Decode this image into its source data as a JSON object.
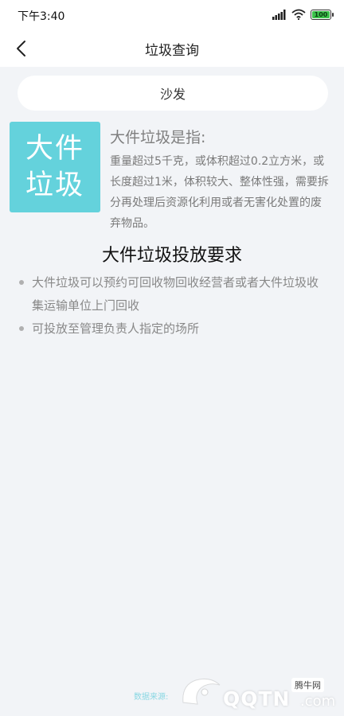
{
  "status_bar": {
    "time": "下午3:40",
    "battery_level": "100",
    "icons": [
      "signal-icon",
      "wifi-icon",
      "battery-icon"
    ],
    "battery_color": "#3cc24b"
  },
  "nav": {
    "title": "垃圾查询",
    "back_icon": "chevron-left-icon"
  },
  "search": {
    "value": "沙发"
  },
  "badge": {
    "line1": "大件",
    "line2": "垃圾",
    "color": "#64d2dc"
  },
  "definition": {
    "title": "大件垃圾是指:",
    "body": "重量超过5千克，或体积超过0.2立方米，或长度超过1米，体积较大、整体性强，需要拆分再处理后资源化利用或者无害化处置的废弃物品。"
  },
  "requirements": {
    "title": "大件垃圾投放要求",
    "items": [
      "大件垃圾可以预约可回收物回收经营者或者大件垃圾收集运输单位上门回收",
      "可投放至管理负责人指定的场所"
    ]
  },
  "footer": {
    "source_text": "数据来源:",
    "watermark_text": "QQTN",
    "watermark_domain": ".com",
    "watermark_label": "腾牛网"
  }
}
